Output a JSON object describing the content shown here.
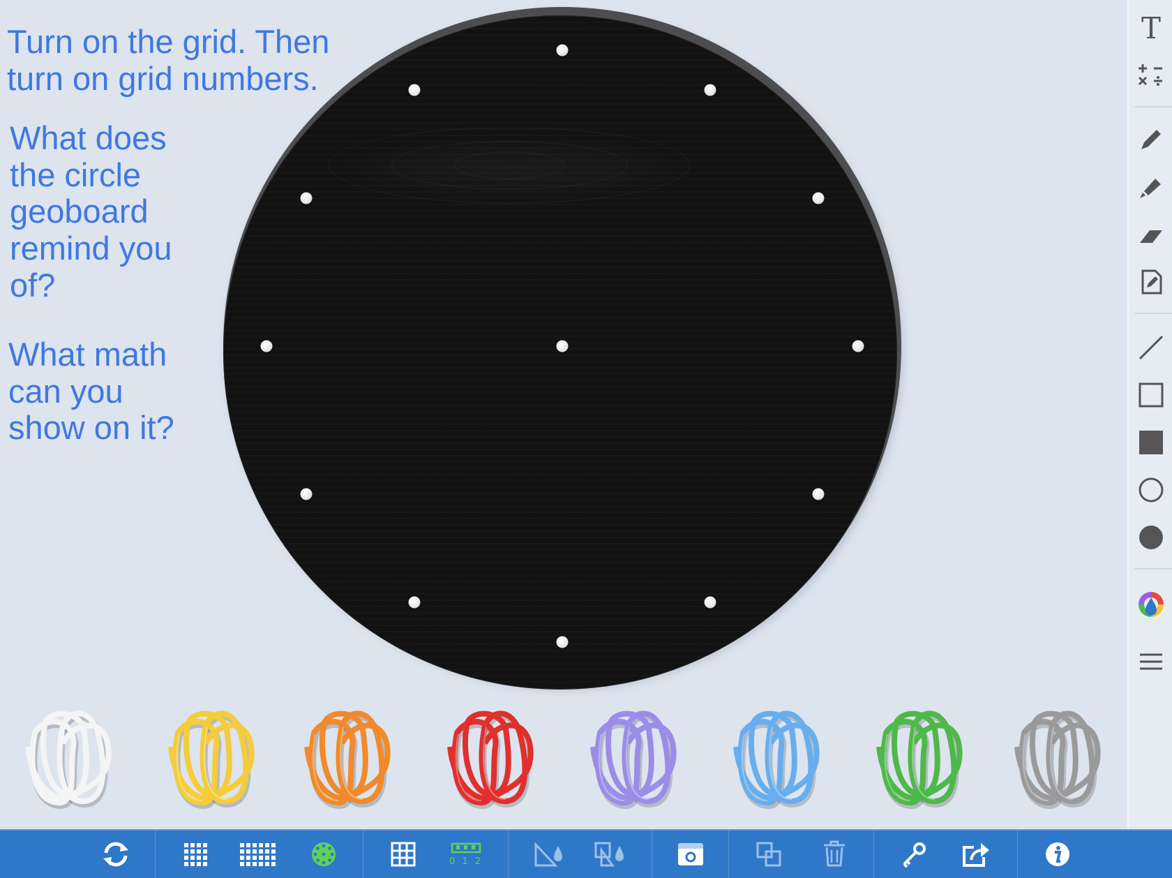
{
  "instructions": {
    "line1": "Turn on the grid. Then\nturn on grid numbers.",
    "line2": "What does\nthe circle\ngeoboard\nremind you\nof?",
    "line3": "What math\ncan you\nshow on it?"
  },
  "board": {
    "type": "circle-geoboard",
    "peg_count": 13,
    "color": "#141414",
    "rim_color": "#4d4d4f"
  },
  "rubber_bands": [
    {
      "name": "white",
      "color": "#f4f4f4"
    },
    {
      "name": "yellow",
      "color": "#f5cc3a"
    },
    {
      "name": "orange",
      "color": "#f08a2c"
    },
    {
      "name": "red",
      "color": "#e0302e"
    },
    {
      "name": "purple",
      "color": "#9b8ce8"
    },
    {
      "name": "blue",
      "color": "#68aeee"
    },
    {
      "name": "green",
      "color": "#4fb84a"
    },
    {
      "name": "gray",
      "color": "#9a9a9a"
    }
  ],
  "right_toolbar": {
    "text_tool": "T",
    "items": [
      "text-icon",
      "math-symbols-icon",
      "pencil-icon",
      "highlighter-icon",
      "eraser-icon",
      "edit-note-icon",
      "line-icon",
      "rectangle-outline-icon",
      "rectangle-filled-icon",
      "circle-outline-icon",
      "circle-filled-icon",
      "color-palette-icon",
      "menu-icon"
    ]
  },
  "bottom_toolbar": {
    "items": [
      "refresh-icon",
      "grid-small-icon",
      "grid-large-icon",
      "circle-board-icon",
      "grid-lines-icon",
      "grid-numbers-icon",
      "measure-angle-icon",
      "fill-shape-icon",
      "camera-icon",
      "duplicate-icon",
      "trash-icon",
      "key-icon",
      "share-icon",
      "info-icon"
    ],
    "grid_numbers_label": "0 1 2",
    "active_color": "#5fd25a"
  }
}
